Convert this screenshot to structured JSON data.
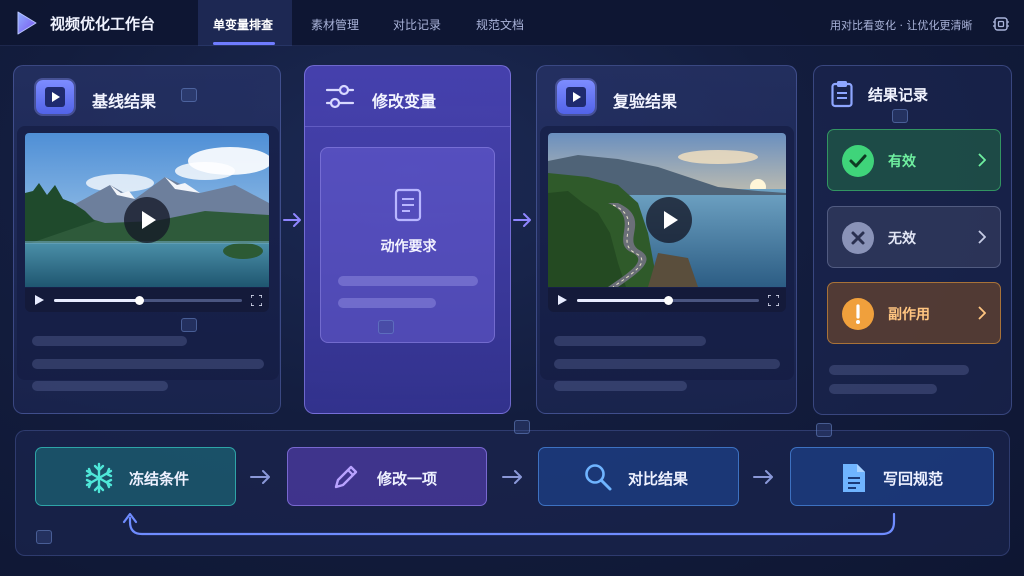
{
  "app": {
    "title": "视频优化工作台",
    "slogan": "用对比看变化 · 让优化更清晰"
  },
  "tabs": [
    {
      "label": "单变量排查",
      "active": true
    },
    {
      "label": "素材管理",
      "active": false
    },
    {
      "label": "对比记录",
      "active": false
    },
    {
      "label": "规范文档",
      "active": false
    }
  ],
  "panels": {
    "baseline": {
      "title": "基线结果",
      "icon": "play-icon",
      "progress": 0.45
    },
    "modify": {
      "title": "修改变量",
      "icon": "sliders-icon",
      "card_label": "动作要求",
      "card_icon": "document-icon"
    },
    "retest": {
      "title": "复验结果",
      "icon": "play-icon",
      "progress": 0.5
    },
    "record": {
      "title": "结果记录",
      "icon": "clipboard-icon",
      "items": [
        {
          "label": "有效",
          "icon": "check-icon",
          "color": "#3fd47a"
        },
        {
          "label": "无效",
          "icon": "x-icon",
          "color": "#8a93b8"
        },
        {
          "label": "副作用",
          "icon": "exclamation-icon",
          "color": "#f0a03c"
        }
      ]
    }
  },
  "flow": {
    "steps": [
      {
        "label": "冻结条件",
        "icon": "snowflake-icon",
        "color": "#2fd3c6"
      },
      {
        "label": "修改一项",
        "icon": "pencil-icon",
        "color": "#a98bff"
      },
      {
        "label": "对比结果",
        "icon": "search-icon",
        "color": "#5aa8ff"
      },
      {
        "label": "写回规范",
        "icon": "document-icon",
        "color": "#5aa8ff"
      }
    ]
  }
}
